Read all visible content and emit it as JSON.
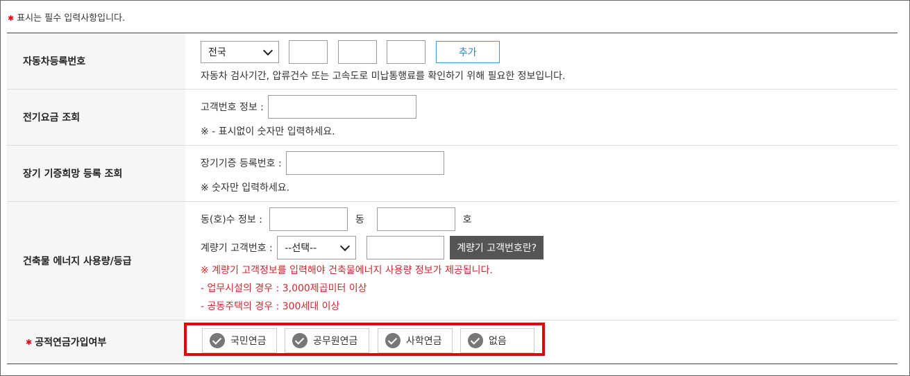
{
  "notice": {
    "star": "✱",
    "text": "표시는 필수 입력사항입니다."
  },
  "vehicle": {
    "label": "자동차등록번호",
    "region_selected": "전국",
    "add_button": "추가",
    "help": "자동차 검사기간, 압류건수 또는 고속도로 미납통행료를 확인하기 위해 필요한 정보입니다."
  },
  "electric": {
    "label": "전기요금 조회",
    "field_label": "고객번호 정보 :",
    "help": "※ - 표시없이 숫자만 입력하세요."
  },
  "donation": {
    "label": "장기 기증희망 등록 조회",
    "field_label": "장기기증 등록번호 :",
    "help": "※ 숫자만 입력하세요."
  },
  "building": {
    "label": "건축물 에너지 사용량/등급",
    "dong_label": "동(호)수 정보 :",
    "dong_suffix": "동",
    "ho_suffix": "호",
    "meter_label": "계량기 고객번호 :",
    "meter_select": "--선택--",
    "meter_help_button": "계량기 고객번호란?",
    "notes": [
      "※ 계량기 고객정보를 입력해야 건축물에너지 사용량 정보가 제공됩니다.",
      "- 업무시설의 경우 : 3,000제곱미터 이상",
      "- 공동주택의 경우 : 300세대 이상"
    ]
  },
  "pension": {
    "star": "✱",
    "label": "공적연금가입여부",
    "options": [
      "국민연금",
      "공무원연금",
      "사학연금",
      "없음"
    ]
  }
}
